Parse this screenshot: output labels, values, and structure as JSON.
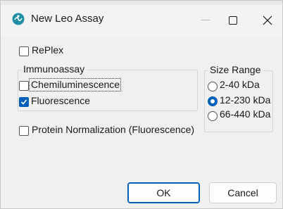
{
  "window": {
    "title": "New Leo Assay",
    "app_icon": "leo-app-icon",
    "controls": {
      "minimize_icon": "minimize-icon",
      "maximize_icon": "maximize-icon",
      "close_icon": "close-icon"
    }
  },
  "options": {
    "replex": {
      "label": "RePlex",
      "checked": false
    },
    "protein_normalization": {
      "label": "Protein Normalization (Fluorescence)",
      "checked": false
    }
  },
  "immunoassay": {
    "title": "Immunoassay",
    "items": [
      {
        "label": "Chemiluminescence",
        "checked": false,
        "focused": true
      },
      {
        "label": "Fluorescence",
        "checked": true
      }
    ]
  },
  "size_range": {
    "title": "Size Range",
    "options": [
      {
        "label": "2-40 kDa",
        "selected": false
      },
      {
        "label": "12-230 kDa",
        "selected": true
      },
      {
        "label": "66-440 kDa",
        "selected": false
      }
    ]
  },
  "buttons": {
    "ok": "OK",
    "cancel": "Cancel"
  },
  "colors": {
    "accent": "#005fb8",
    "window_bg": "#f0f0f0"
  }
}
